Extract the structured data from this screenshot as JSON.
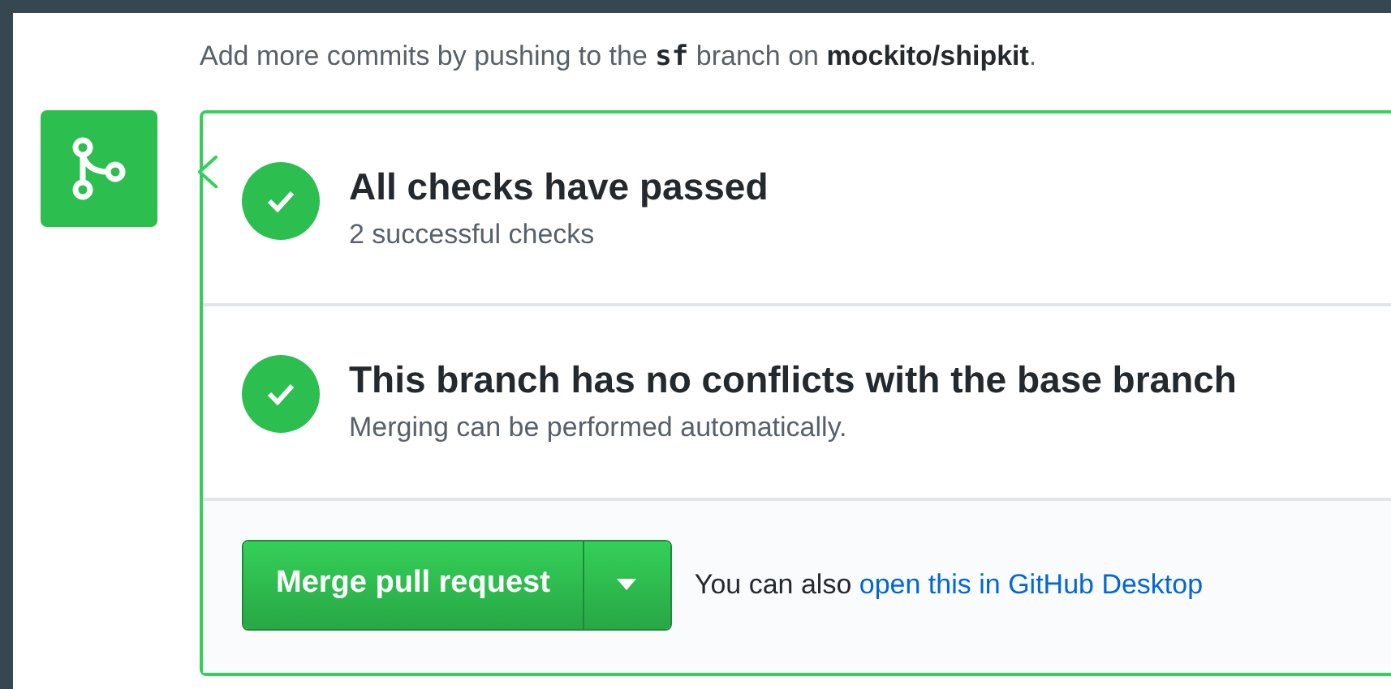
{
  "intro": {
    "before": "Add more commits by pushing to the",
    "branch": "sf",
    "middle": "branch on",
    "repo": "mockito/shipkit",
    "after": "."
  },
  "sections": [
    {
      "kind": "success",
      "title": "All checks have passed",
      "subtitle": "2 successful checks"
    },
    {
      "kind": "success",
      "title": "This branch has no conflicts with the base branch",
      "subtitle": "Merging can be performed automatically."
    }
  ],
  "merge": {
    "button": "Merge pull request",
    "hint": "You can also",
    "link": "open this in GitHub Desktop"
  }
}
